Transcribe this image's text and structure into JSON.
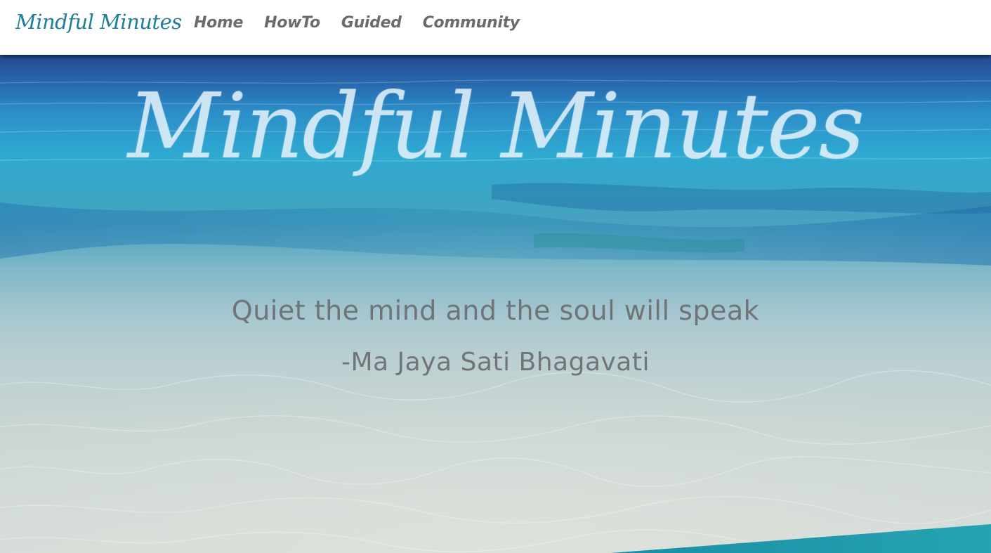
{
  "brand": {
    "logo_text": "Mindful Minutes"
  },
  "nav": {
    "items": [
      {
        "label": "Home"
      },
      {
        "label": "HowTo"
      },
      {
        "label": "Guided"
      },
      {
        "label": "Community"
      }
    ]
  },
  "hero": {
    "title": "Mindful Minutes",
    "quote": "Quiet the mind and the soul will speak",
    "quote_author": "-Ma Jaya Sati Bhagavati",
    "background_image": "ocean-water-photo"
  },
  "colors": {
    "brand": "#1f7f98",
    "nav_text": "#6b6b6b",
    "accent_wedge": "#1f97a8"
  }
}
